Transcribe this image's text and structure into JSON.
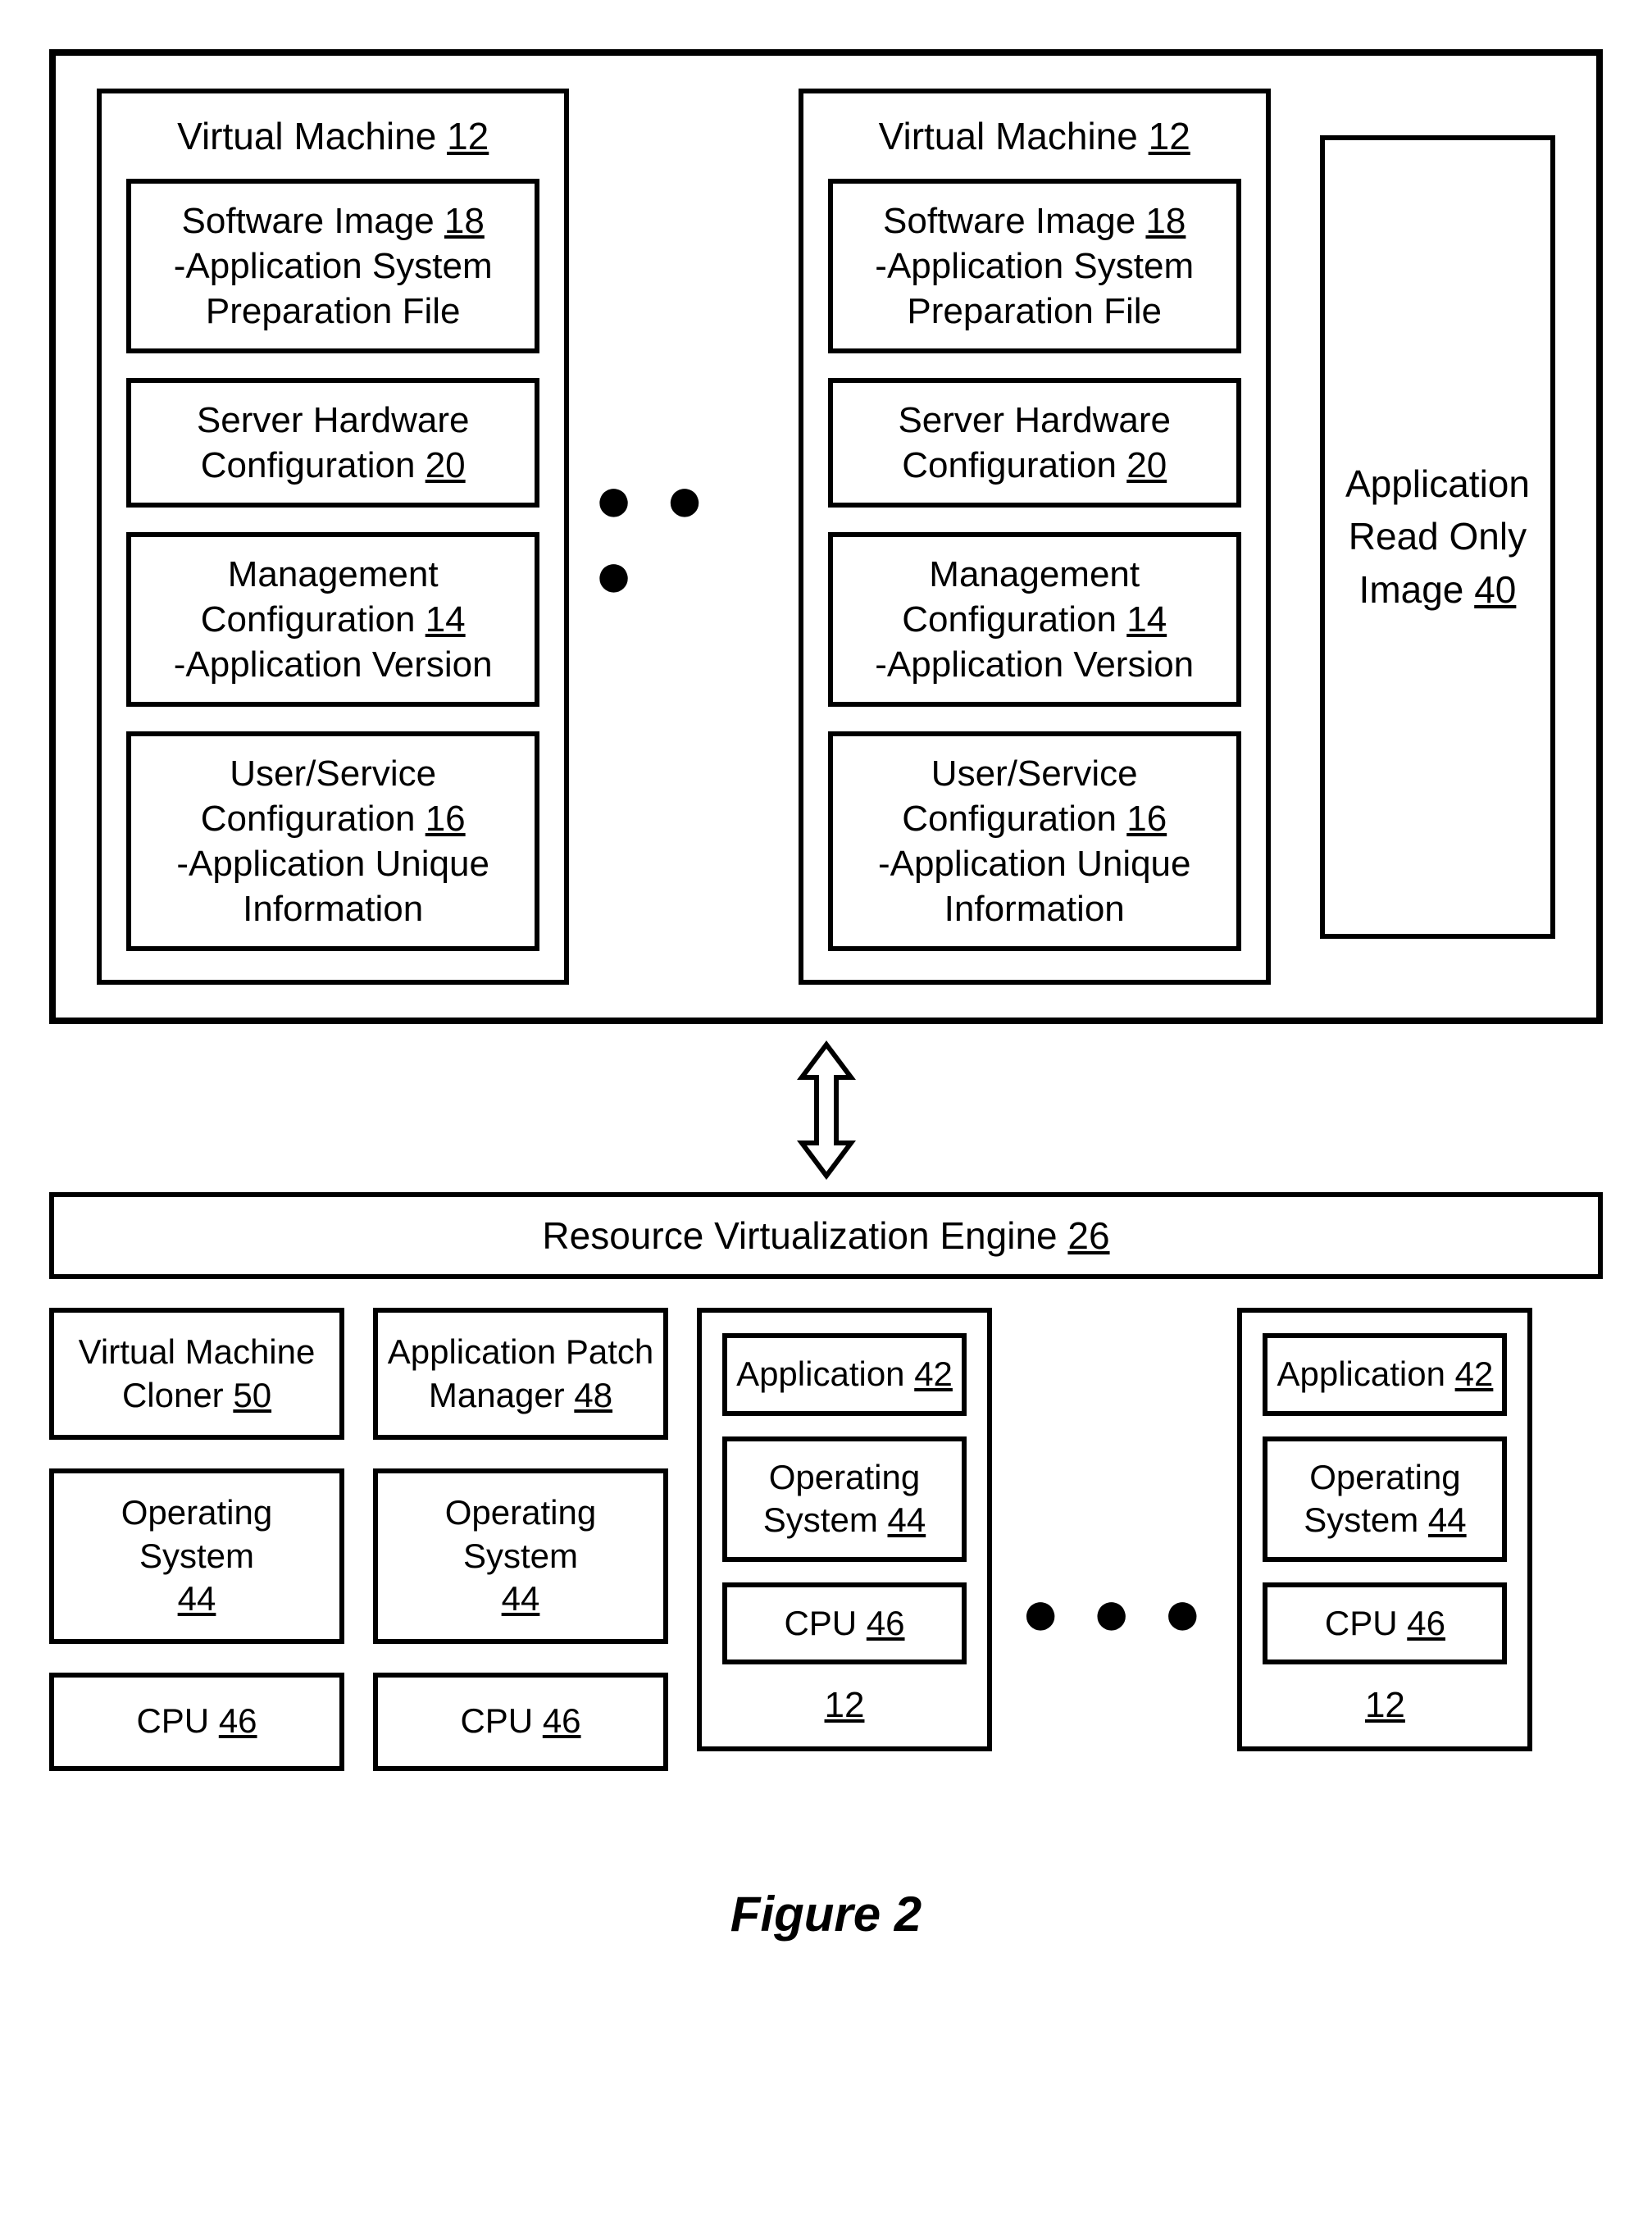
{
  "top": {
    "vm_title_prefix": "Virtual Machine ",
    "vm_ref": "12",
    "software_image_label": "Software Image ",
    "software_image_ref": "18",
    "software_image_line2": "-Application System",
    "software_image_line3": "Preparation File",
    "server_hw_line1": "Server Hardware",
    "server_hw_line2_prefix": "Configuration ",
    "server_hw_ref": "20",
    "mgmt_line1": "Management",
    "mgmt_line2_prefix": "Configuration ",
    "mgmt_ref": "14",
    "mgmt_line3": "-Application Version",
    "user_svc_line1": "User/Service",
    "user_svc_line2_prefix": "Configuration ",
    "user_svc_ref": "16",
    "user_svc_line3": "-Application Unique",
    "user_svc_line4": "Information",
    "readonly_line1": "Application",
    "readonly_line2": "Read Only",
    "readonly_line3_prefix": "Image ",
    "readonly_ref": "40"
  },
  "rve": {
    "label_prefix": "Resource Virtualization Engine ",
    "ref": "26"
  },
  "bottom": {
    "vm_cloner_line1": "Virtual Machine",
    "vm_cloner_line2_prefix": "Cloner ",
    "vm_cloner_ref": "50",
    "patch_mgr_line1": "Application Patch",
    "patch_mgr_line2_prefix": "Manager ",
    "patch_mgr_ref": "48",
    "os_label": "Operating System",
    "os_ref": "44",
    "cpu_prefix": "CPU ",
    "cpu_ref": "46",
    "app_prefix": "Application ",
    "app_ref": "42",
    "os_short_line1": "Operating",
    "os_short_line2_prefix": "System ",
    "vm_instance_ref": "12"
  },
  "figure_label": "Figure 2",
  "ellipsis": "● ● ●"
}
